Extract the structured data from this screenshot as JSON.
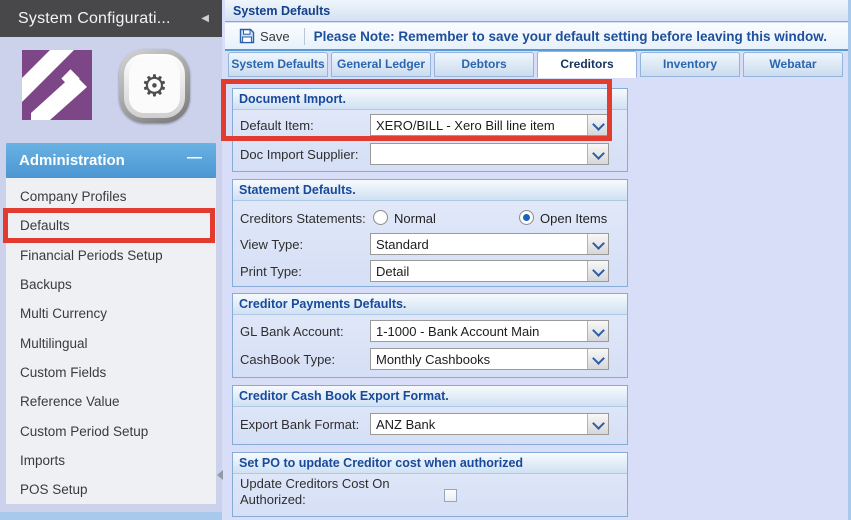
{
  "colors": {
    "annotation_red": "#e23c30",
    "accent_blue": "#2a66b0",
    "header_navy": "#18499b",
    "admin_header_blue": "#4b96d2"
  },
  "sidebar": {
    "title": "System Configurati...",
    "collapse_icon": "◀",
    "section_header": "Administration",
    "collapse_glyph": "—",
    "settings_glyph": "⚙",
    "active_item": "Defaults",
    "items": [
      "Company Profiles",
      "Defaults",
      "Financial Periods Setup",
      "Backups",
      "Multi Currency",
      "Multilingual",
      "Custom Fields",
      "Reference Value",
      "Custom Period Setup",
      "Imports",
      "POS Setup"
    ]
  },
  "main": {
    "panel_title": "System Defaults",
    "toolbar": {
      "save_label": "Save",
      "note": "Please Note: Remember to save your default setting before leaving this window."
    },
    "active_tab": "Creditors",
    "tabs": [
      "System Defaults",
      "General Ledger",
      "Debtors",
      "Creditors",
      "Inventory",
      "Webatar"
    ],
    "sections": [
      {
        "title": "Document Import.",
        "rows": [
          {
            "label": "Default Item:",
            "value": "XERO/BILL - Xero Bill line item"
          },
          {
            "label": "Doc Import Supplier:",
            "value": ""
          }
        ]
      },
      {
        "title": "Statement Defaults.",
        "radio_row": {
          "label": "Creditors Statements:",
          "options": [
            {
              "label": "Normal",
              "selected": false
            },
            {
              "label": "Open Items",
              "selected": true
            }
          ]
        },
        "rows": [
          {
            "label": "View Type:",
            "value": "Standard"
          },
          {
            "label": "Print Type:",
            "value": "Detail"
          }
        ]
      },
      {
        "title": "Creditor Payments Defaults.",
        "rows": [
          {
            "label": "GL Bank Account:",
            "value": "1-1000 - Bank Account Main"
          },
          {
            "label": "CashBook Type:",
            "value": "Monthly Cashbooks"
          }
        ]
      },
      {
        "title": "Creditor Cash Book Export Format.",
        "rows": [
          {
            "label": "Export Bank Format:",
            "value": "ANZ Bank"
          }
        ]
      },
      {
        "title": "Set PO to update Creditor cost when authorized",
        "checkbox_row": {
          "label": "Update Creditors Cost On Authorized:",
          "checked": false
        }
      }
    ]
  }
}
